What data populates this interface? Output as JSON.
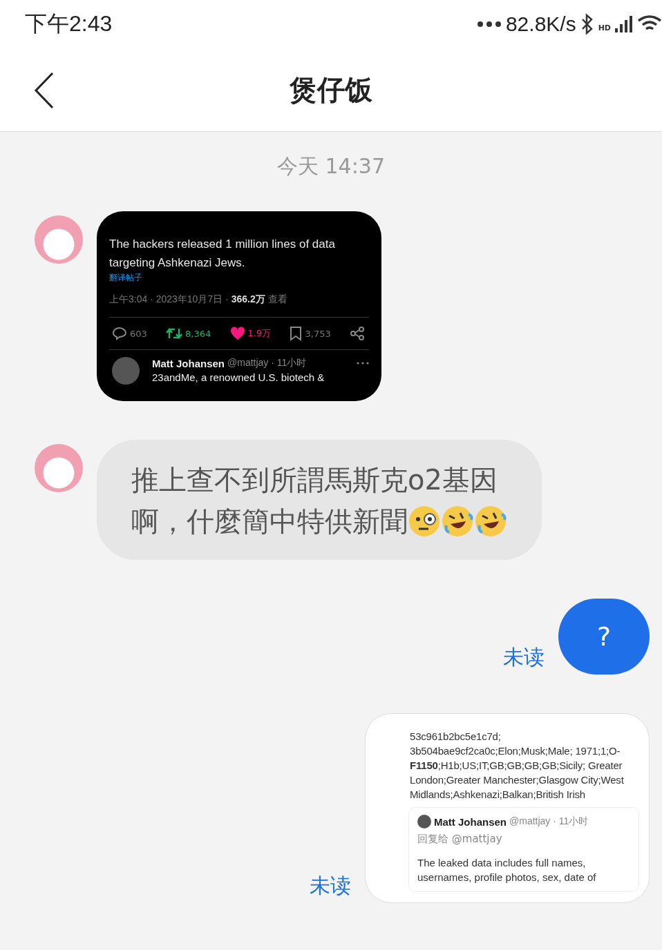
{
  "status_bar": {
    "time": "下午2:43",
    "speed": "82.8K/s",
    "network_badge": "HD"
  },
  "header": {
    "title": "煲仔饭"
  },
  "timestamp": "今天 14:37",
  "messages": [
    {
      "kind": "tweet_image",
      "outgoing": false,
      "tweet": {
        "text": "The hackers released 1 million lines of data targeting Ashkenazi Jews.",
        "translate": "翻译帖子",
        "meta": "上午3:04 · 2023年10月7日 · **366.2万** 查看",
        "stats": [
          {
            "kind": "reply",
            "count": "603"
          },
          {
            "kind": "retweet",
            "count": "8,364"
          },
          {
            "kind": "like",
            "count": "1.9万"
          },
          {
            "kind": "bookmark",
            "count": "3,753"
          },
          {
            "kind": "share"
          }
        ],
        "reply": {
          "name": "Matt Johansen",
          "handle": "@mattjay · 11小时",
          "text": "23andMe, a renowned U.S. biotech &"
        }
      }
    },
    {
      "kind": "text",
      "outgoing": false,
      "lines": [
        "推上查不到所謂馬斯克o2基因",
        "啊，什麼簡中特供新聞"
      ],
      "emojis": [
        {
          "kind": "monocle"
        },
        {
          "kind": "rofl"
        },
        {
          "kind": "rofl"
        }
      ]
    },
    {
      "kind": "text",
      "outgoing": true,
      "lines": [
        "?"
      ],
      "receipt": "未读"
    },
    {
      "kind": "data_image",
      "outgoing": true,
      "receipt": "未读",
      "data": "53c961b2bc5e1c7d; 3b504bae9cf2ca0c;Elon;Musk;Male; 1971;1;O-**F1150**;H1b;US;IT;GB;GB;GB;GB;Sicily; Greater London;Greater Manchester;Glasgow City;West Midlands;Ashkenazi;Balkan;British Irish",
      "quote": {
        "name": "Matt Johansen",
        "handle": "@mattjay · 11小时",
        "reply_to": "回复给 @mattjay",
        "text": "The leaked data includes full names, usernames, profile photos, sex, date of"
      }
    }
  ]
}
